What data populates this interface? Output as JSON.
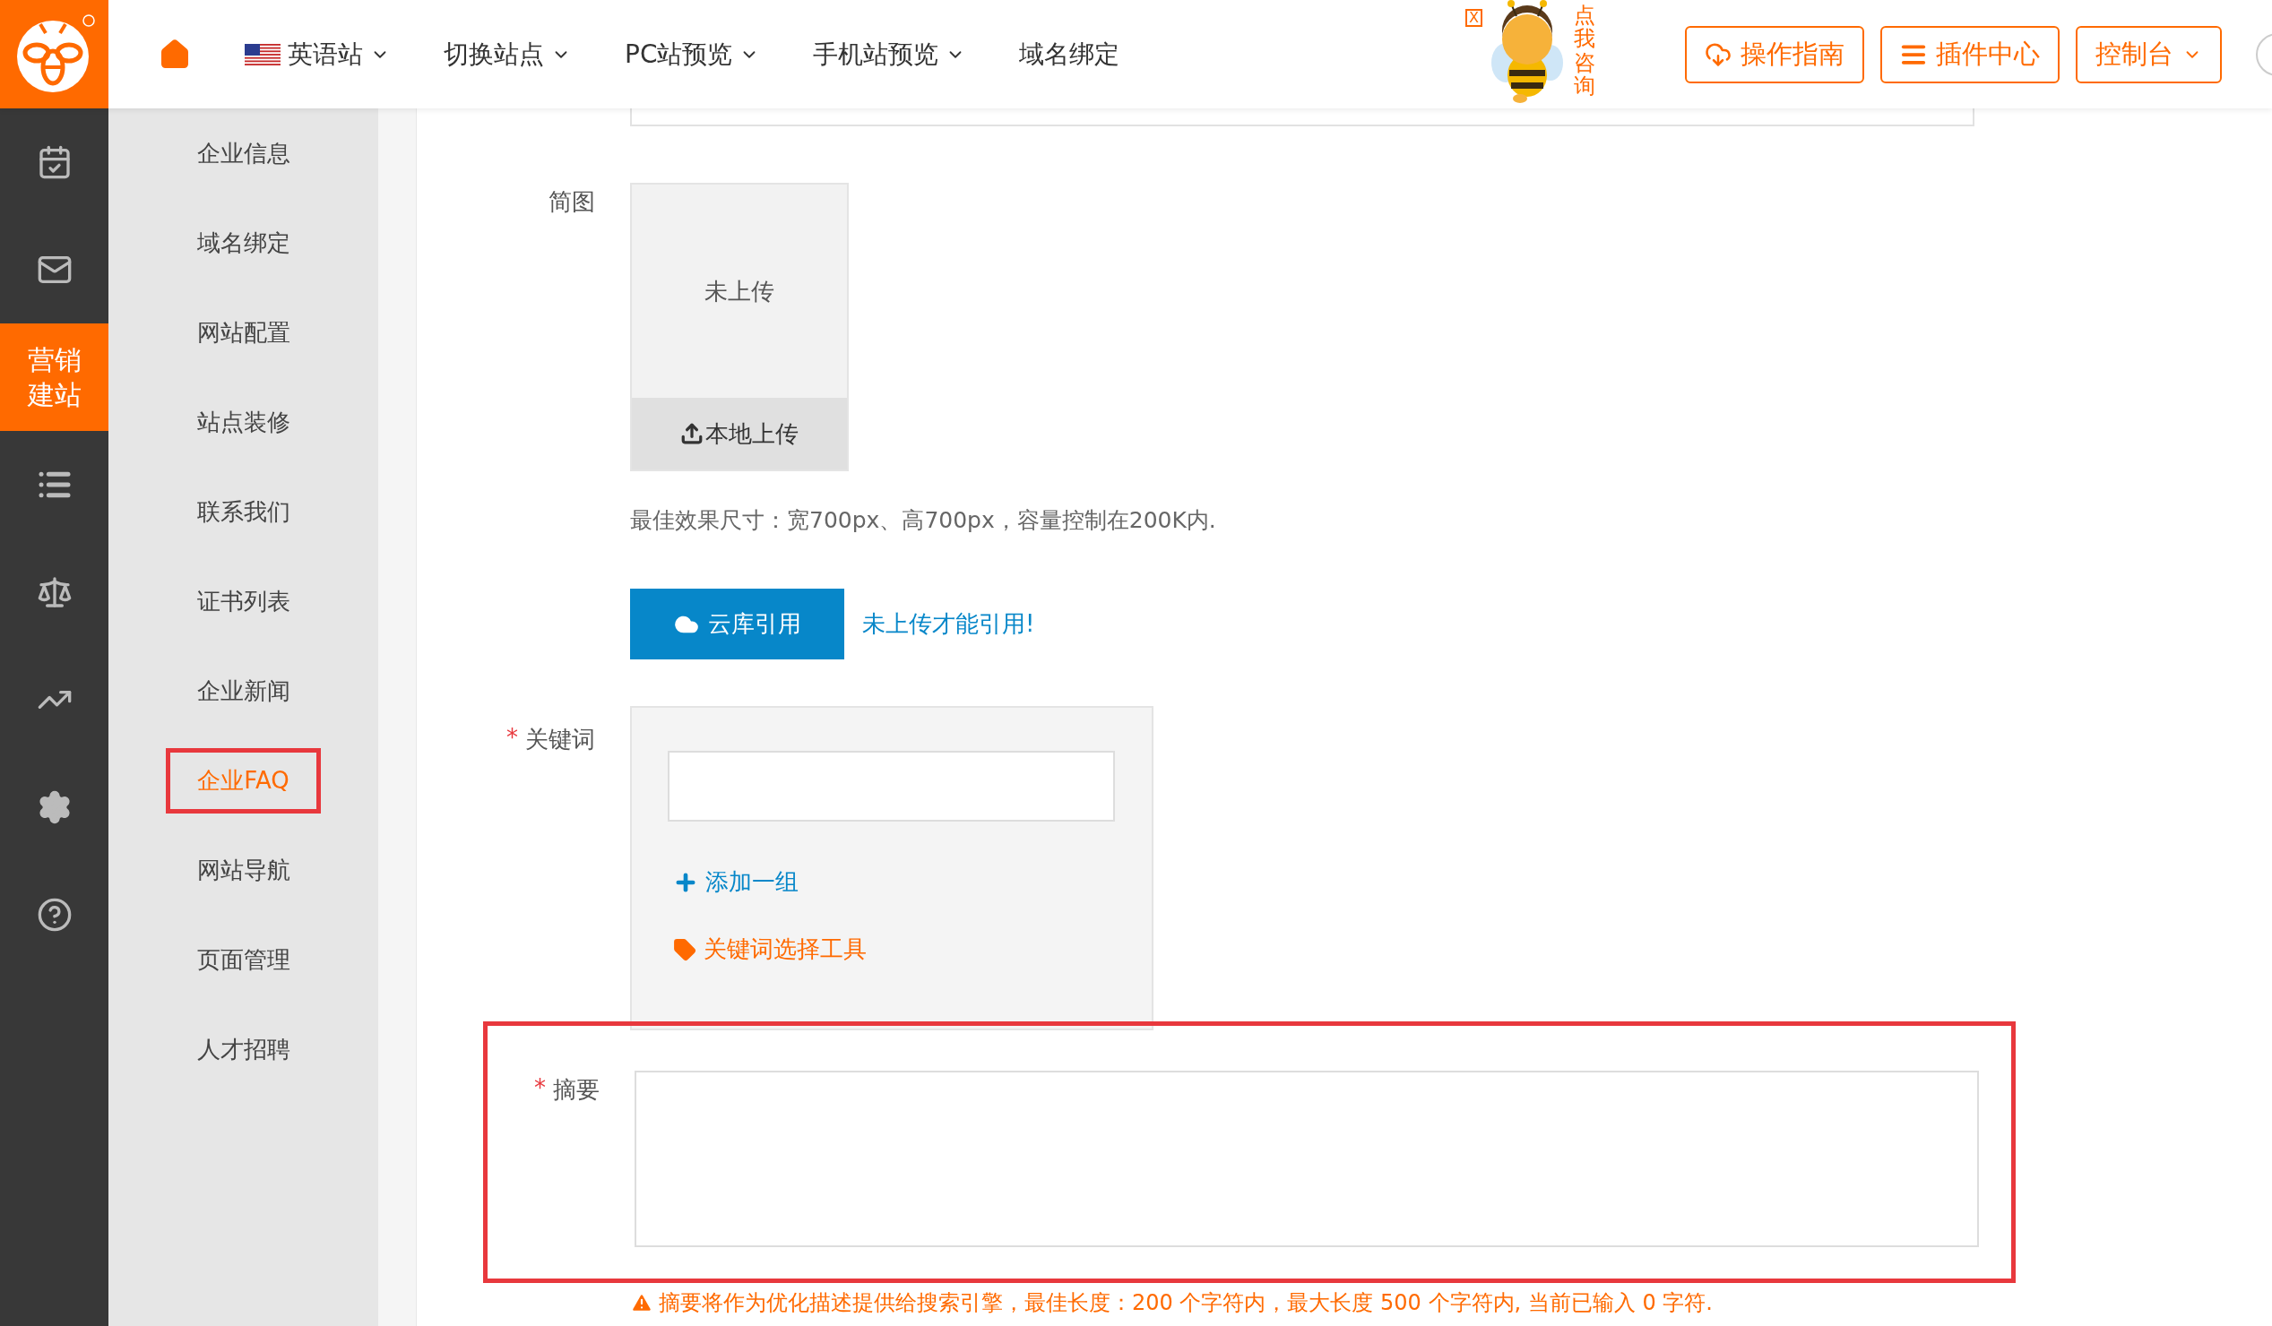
{
  "header": {
    "nav": [
      {
        "kind": "home"
      },
      {
        "kind": "flag",
        "label": "英语站",
        "dropdown": true
      },
      {
        "kind": "text",
        "label": "切换站点",
        "dropdown": true
      },
      {
        "kind": "text",
        "label": "PC站预览",
        "dropdown": true
      },
      {
        "kind": "text",
        "label": "手机站预览",
        "dropdown": true
      },
      {
        "kind": "text",
        "label": "域名绑定",
        "dropdown": false
      }
    ],
    "mascot": {
      "close": "X",
      "caption": "点我咨询"
    },
    "buttons": [
      {
        "kind": "guide",
        "label": "操作指南",
        "dropdown": false
      },
      {
        "kind": "plugins",
        "label": "插件中心",
        "dropdown": false
      },
      {
        "kind": "console",
        "label": "控制台",
        "dropdown": true
      }
    ]
  },
  "rail": [
    {
      "kind": "calendar",
      "selected": false
    },
    {
      "kind": "mail",
      "selected": false
    },
    {
      "kind": "text",
      "label": "营销建站",
      "selected": true
    },
    {
      "kind": "list",
      "selected": false
    },
    {
      "kind": "scale",
      "selected": false
    },
    {
      "kind": "chart",
      "selected": false
    },
    {
      "kind": "settings",
      "selected": false
    },
    {
      "kind": "help",
      "selected": false
    }
  ],
  "subnav": [
    {
      "label": "企业信息",
      "selected": false,
      "highlighted": false
    },
    {
      "label": "域名绑定",
      "selected": false,
      "highlighted": false
    },
    {
      "label": "网站配置",
      "selected": false,
      "highlighted": false
    },
    {
      "label": "站点装修",
      "selected": false,
      "highlighted": false
    },
    {
      "label": "联系我们",
      "selected": false,
      "highlighted": false
    },
    {
      "label": "证书列表",
      "selected": false,
      "highlighted": false
    },
    {
      "label": "企业新闻",
      "selected": false,
      "highlighted": false
    },
    {
      "label": "企业FAQ",
      "selected": true,
      "highlighted": true
    },
    {
      "label": "网站导航",
      "selected": false,
      "highlighted": false
    },
    {
      "label": "页面管理",
      "selected": false,
      "highlighted": false
    },
    {
      "label": "人才招聘",
      "selected": false,
      "highlighted": false
    }
  ],
  "form": {
    "image": {
      "label": "简图",
      "empty_text": "未上传",
      "upload": "本地上传",
      "hint": "最佳效果尺寸：宽700px、高700px，容量控制在200K内.",
      "cloud_button": "云库引用",
      "cloud_note": "未上传才能引用!"
    },
    "keywords": {
      "label": "关键词",
      "required_mark": "*",
      "add": "添加一组",
      "tool": "关键词选择工具"
    },
    "summary": {
      "label": "摘要",
      "required_mark": "*",
      "highlighted": true,
      "warning": "摘要将作为优化描述提供给搜索引擎，最佳长度：200 个字符内，最大长度 500 个字符内, 当前已输入 0 字符."
    }
  }
}
